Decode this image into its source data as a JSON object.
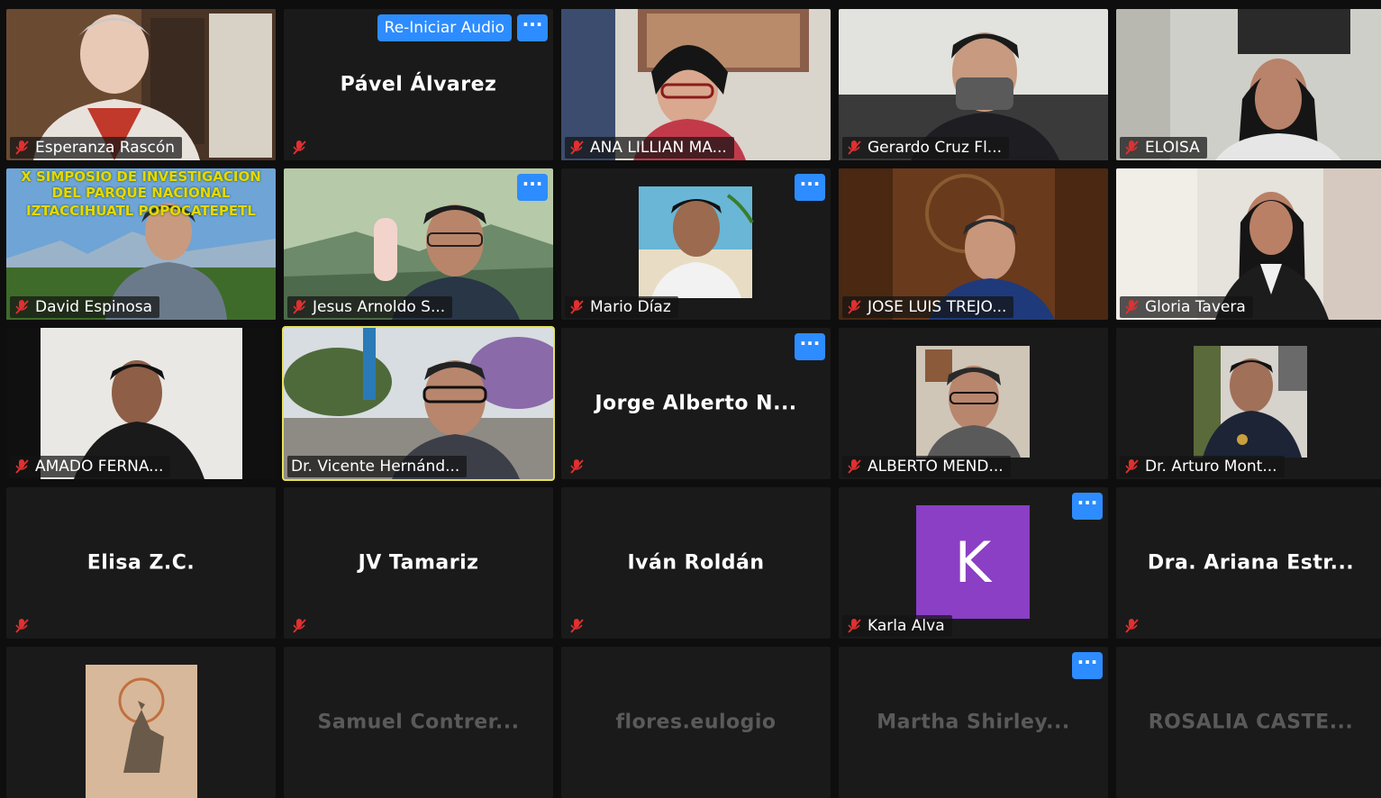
{
  "controls": {
    "reiniciar_audio": "Re-Iniciar Audio",
    "more": "···"
  },
  "banner": {
    "line1": "X SIMPOSIO DE INVESTIGACION",
    "line2": "DEL PARQUE NACIONAL",
    "line3": "IZTACCIHUATL POPOCATEPETL"
  },
  "avatar_letter": "K",
  "participants": [
    {
      "name": "Esperanza Rascón"
    },
    {
      "name": "Pável Álvarez"
    },
    {
      "name": "ANA LILLIAN MA..."
    },
    {
      "name": "Gerardo Cruz Fl..."
    },
    {
      "name": "ELOISA"
    },
    {
      "name": "David Espinosa"
    },
    {
      "name": "Jesus Arnoldo S..."
    },
    {
      "name": "Mario Díaz"
    },
    {
      "name": "JOSE LUIS TREJO..."
    },
    {
      "name": "Gloria Tavera"
    },
    {
      "name": "AMADO FERNA..."
    },
    {
      "name": "Dr. Vicente Hernánd..."
    },
    {
      "name": "Jorge Alberto N..."
    },
    {
      "name": "ALBERTO MEND..."
    },
    {
      "name": "Dr. Arturo Mont..."
    },
    {
      "name": "Elisa Z.C."
    },
    {
      "name": "JV Tamariz"
    },
    {
      "name": "Iván Roldán"
    },
    {
      "name": "Karla Alva"
    },
    {
      "name": "Dra. Ariana Estr..."
    },
    {
      "name": ""
    },
    {
      "name": "Samuel Contrer..."
    },
    {
      "name": "flores.eulogio"
    },
    {
      "name": "Martha Shirley..."
    },
    {
      "name": "ROSALIA CASTE..."
    }
  ]
}
